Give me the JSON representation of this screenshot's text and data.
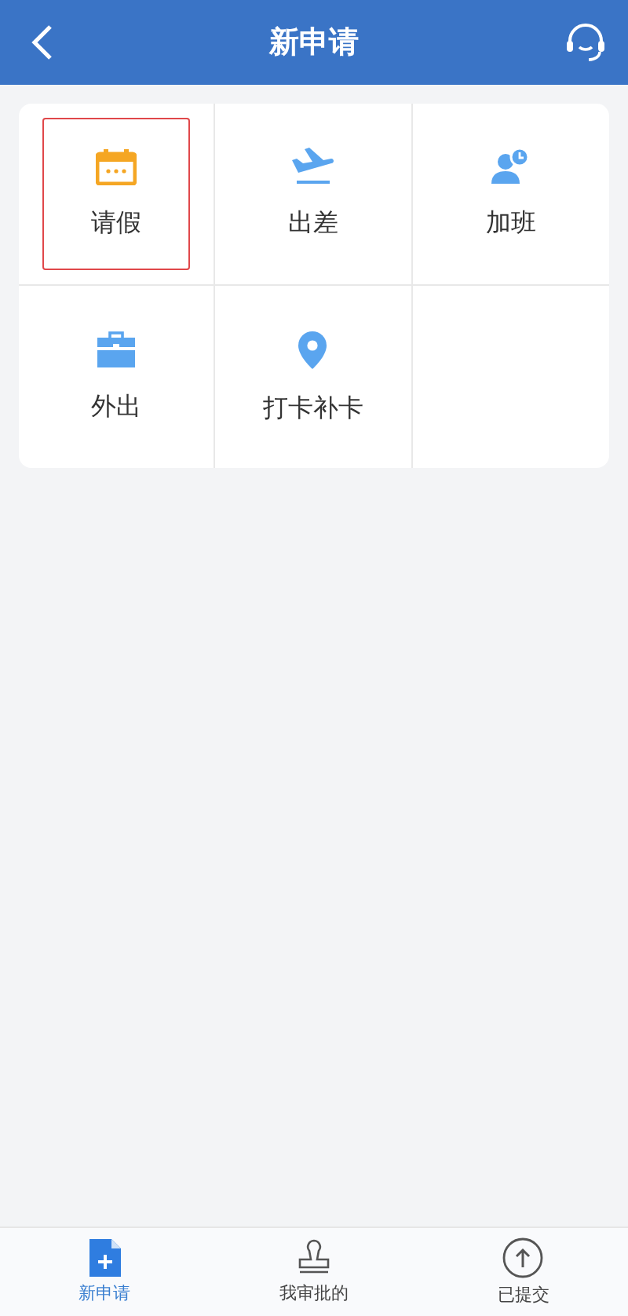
{
  "header": {
    "title": "新申请"
  },
  "items": [
    {
      "kind": "leave",
      "label": "请假",
      "selected": true
    },
    {
      "kind": "trip",
      "label": "出差",
      "selected": false
    },
    {
      "kind": "overtime",
      "label": "加班",
      "selected": false
    },
    {
      "kind": "out",
      "label": "外出",
      "selected": false
    },
    {
      "kind": "punch",
      "label": "打卡补卡",
      "selected": false
    }
  ],
  "tabs": [
    {
      "kind": "new",
      "label": "新申请",
      "selected": true
    },
    {
      "kind": "approve",
      "label": "我审批的",
      "selected": false
    },
    {
      "kind": "submitted",
      "label": "已提交",
      "selected": false
    }
  ]
}
